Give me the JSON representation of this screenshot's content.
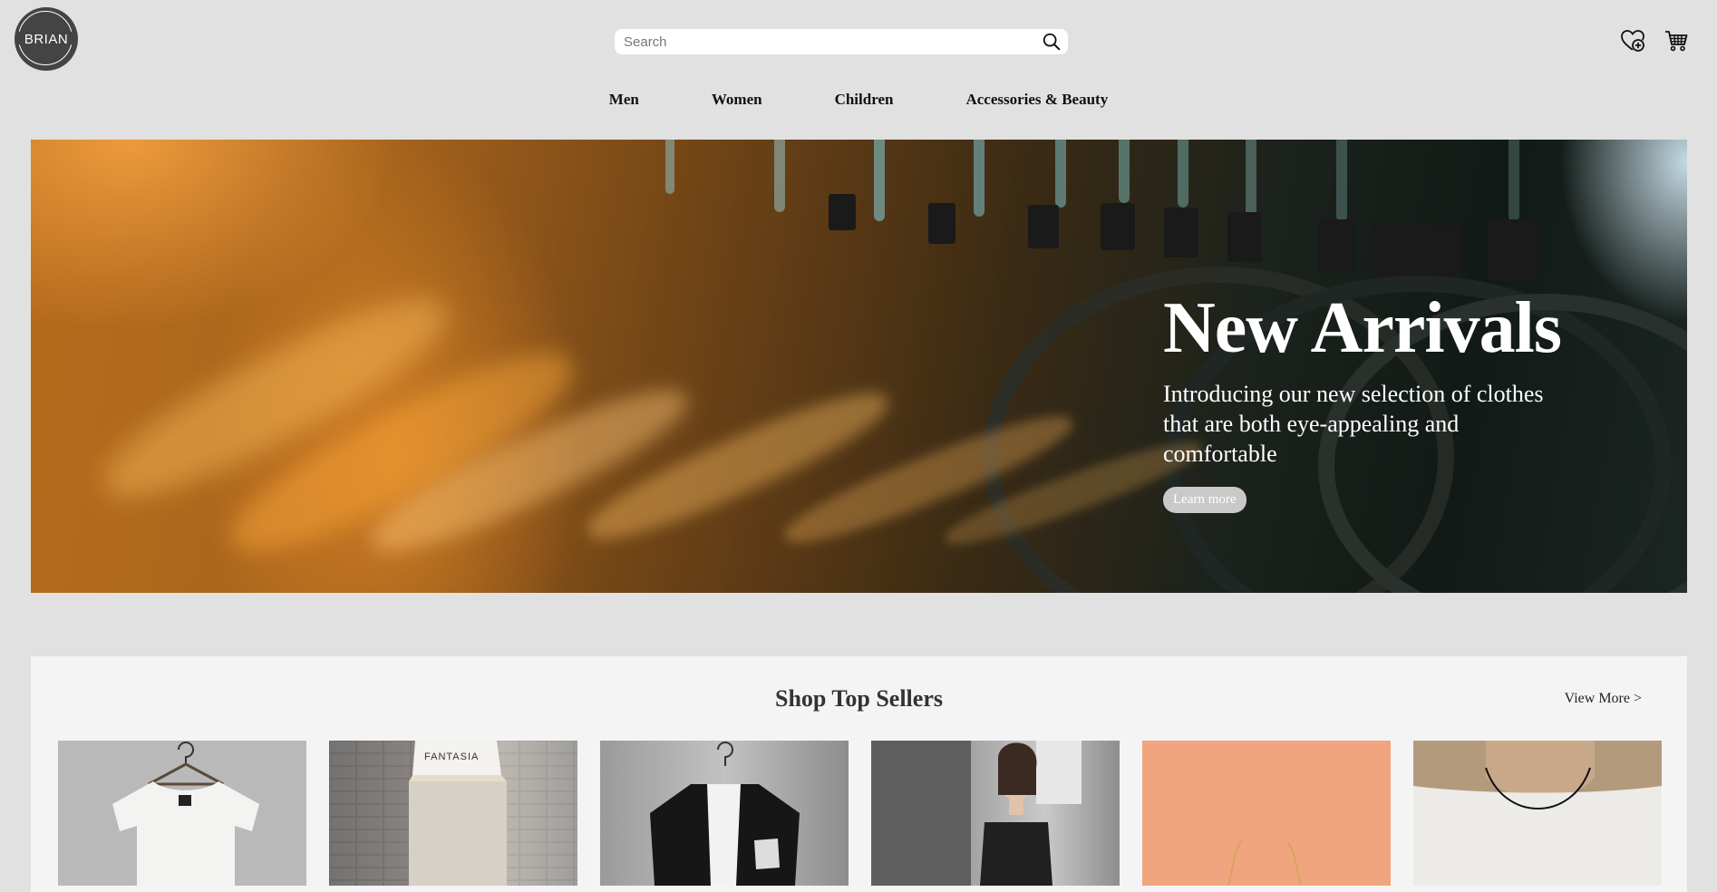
{
  "brand": {
    "logo_text": "BRIAN"
  },
  "search": {
    "placeholder": "Search"
  },
  "nav": {
    "items": [
      "Men",
      "Women",
      "Children",
      "Accessories & Beauty"
    ]
  },
  "hero": {
    "title": "New Arrivals",
    "subtitle": "Introducing our new selection of clothes that are both eye-appealing and comfortable",
    "button_label": "Learn more"
  },
  "top_sellers": {
    "title": "Shop Top Sellers",
    "view_more_label": "View More >",
    "products": [
      {
        "image": "white-tshirt-on-hanger",
        "print_text": ""
      },
      {
        "image": "woman-crop-top-cargo-pants",
        "print_text": "FANTASIA"
      },
      {
        "image": "black-kimono-jacket-on-hanger",
        "print_text": ""
      },
      {
        "image": "woman-black-slip-dress",
        "print_text": ""
      },
      {
        "image": "gold-chain-necklace",
        "print_text": ""
      },
      {
        "image": "man-white-tee-necklace",
        "print_text": ""
      }
    ]
  },
  "icons": [
    "wishlist-heart-icon",
    "cart-icon",
    "search-icon"
  ],
  "colors": {
    "background": "#e1e1e1",
    "panel": "#f4f4f4",
    "logo": "#444444",
    "button": "#c9c9c9"
  }
}
